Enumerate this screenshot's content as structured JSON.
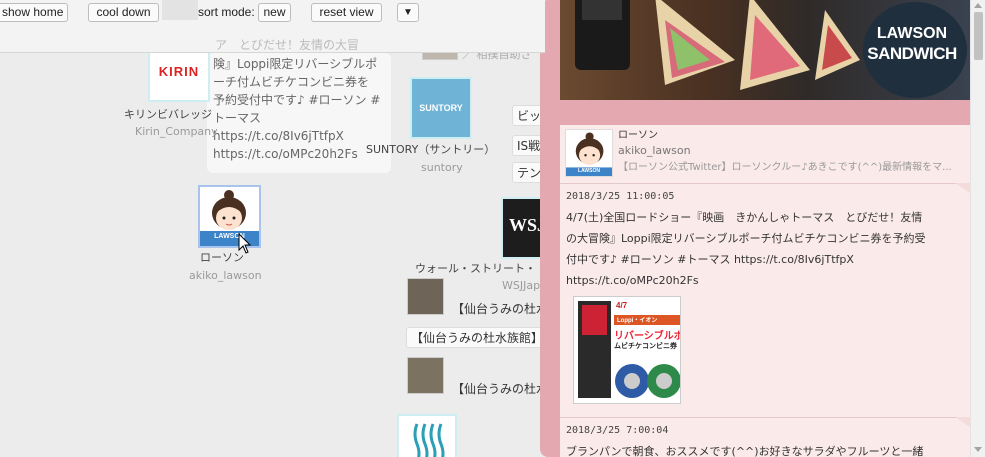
{
  "toolbar": {
    "show_home": "show home",
    "cool_down": "cool down",
    "sort_mode_label": "sort mode:",
    "sort_mode_value": "new",
    "reset_view": "reset view",
    "menu_arrow": "▼"
  },
  "graph": {
    "kirin": {
      "logo_text": "KIRIN",
      "name": "キリンビバレッジ",
      "id": "Kirin_Company"
    },
    "lawson": {
      "badge": "LAWSON",
      "name": "ローソン",
      "id": "akiko_lawson"
    },
    "suntory": {
      "logo_text": "SUNTORY",
      "name": "SUNTORY（サントリー）",
      "id": "suntory"
    },
    "wsj": {
      "logo_text": "WSJ",
      "name": "ウォール・ストリート・",
      "id": "WSJJap"
    },
    "bubble_lines": [
      "ア　とびだせ！友情の大冒",
      "険』Loppi限定リバーシブルポ",
      "ーチ付ムビチケコンビニ券を",
      "予約受付中です♪ #ローソン #",
      "トーマス",
      "https://t.co/8Iv6jTtfpX",
      "https://t.co/oMPc20h2Fs"
    ],
    "top_right_text": "／ 相撲自助さ",
    "chips": [
      "ビッ",
      "IS戦",
      "テン"
    ],
    "aquarium_lines": [
      "【仙台うみの杜水",
      "【仙台うみの杜水族館】",
      "【仙台うみの杜水"
    ]
  },
  "panel": {
    "header_logo_line1": "LAWSON",
    "header_logo_line2": "SANDWICH",
    "profile": {
      "name": "ローソン",
      "handle": "akiko_lawson",
      "bio": "【ローソン公式Twitter】ローソンクルー♪あきこです(^^)最新情報をマ...",
      "avatar_badge": "LAWSON"
    },
    "tweets": [
      {
        "time": "2018/3/25 11:00:05",
        "lines": [
          "4/7(土)全国ロードショー『映画　きかんしゃトーマス　とびだせ！友情",
          "の大冒険』Loppi限定リバーシブルポーチ付ムビチケコンビニ券を予約受",
          "付中です♪ #ローソン #トーマス https://t.co/8Iv6jTtfpX",
          "https://t.co/oMPc20h2Fs"
        ],
        "image_caption_top": "4/7",
        "image_caption_red": "Loppi・イオン",
        "image_title1": "リバーシブルポ",
        "image_title2": "ムビチケコンビニ券"
      },
      {
        "time": "2018/3/25 7:00:04",
        "lines": [
          "ブランパンで朝食、おススメです(^^)お好きなサラダやフルーツと一緒"
        ]
      }
    ]
  },
  "colors": {
    "panel_frame": "#e4a9b0",
    "panel_bg": "#fbeaea",
    "lawson_blue": "#3d83c7",
    "node_border": "#cdeff3",
    "suntory_blue": "#6fb3d6"
  }
}
